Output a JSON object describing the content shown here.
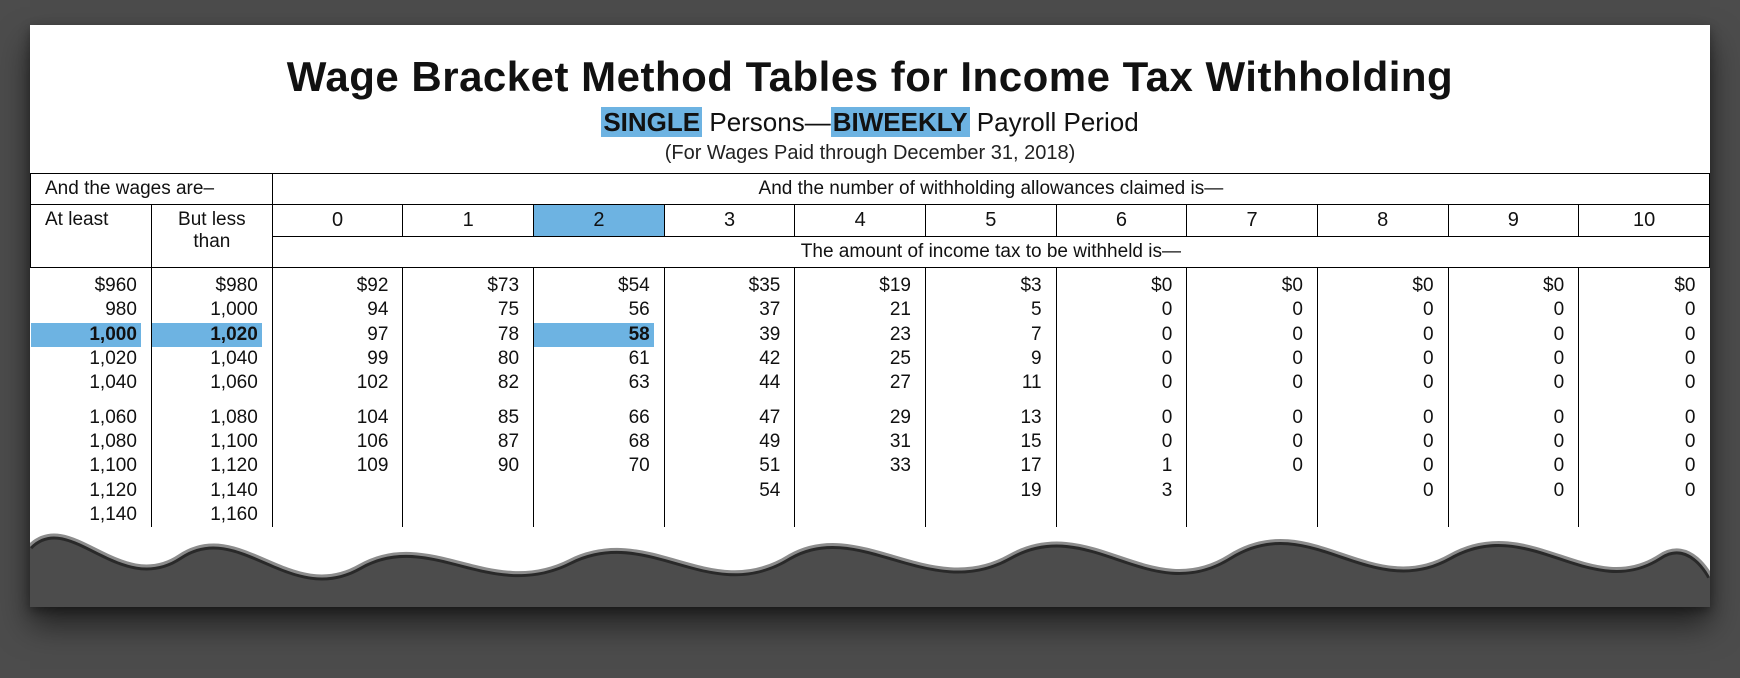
{
  "title": "Wage Bracket Method Tables for Income Tax Withholding",
  "subtitle": {
    "hl1": "SINGLE",
    "mid1": " Persons—",
    "hl2": "BIWEEKLY",
    "mid2": " Payroll Period"
  },
  "date_line": "(For Wages Paid through December 31, 2018)",
  "headers": {
    "wages_label": "And the wages are–",
    "at_least": "At least",
    "but_less_than": "But less than",
    "allowances_label": "And the number of withholding allowances claimed is—",
    "amount_label": "The amount of income tax to be withheld is—",
    "cols": [
      "0",
      "1",
      "2",
      "3",
      "4",
      "5",
      "6",
      "7",
      "8",
      "9",
      "10"
    ]
  },
  "highlight": {
    "col_index": 2,
    "row_index": 2
  },
  "chart_data": {
    "type": "table",
    "title": "Wage Bracket Method Tables for Income Tax Withholding — SINGLE Persons — BIWEEKLY Payroll Period",
    "note": "For Wages Paid through December 31, 2018",
    "x": "Withholding allowances claimed",
    "y": "Wage bracket (at least / but less than)",
    "columns": [
      "at_least",
      "but_less_than",
      "0",
      "1",
      "2",
      "3",
      "4",
      "5",
      "6",
      "7",
      "8",
      "9",
      "10"
    ],
    "rows": [
      {
        "at_least": "$960",
        "but_less_than": "$980",
        "v": [
          "$92",
          "$73",
          "$54",
          "$35",
          "$19",
          "$3",
          "$0",
          "$0",
          "$0",
          "$0",
          "$0"
        ]
      },
      {
        "at_least": "980",
        "but_less_than": "1,000",
        "v": [
          "94",
          "75",
          "56",
          "37",
          "21",
          "5",
          "0",
          "0",
          "0",
          "0",
          "0"
        ]
      },
      {
        "at_least": "1,000",
        "but_less_than": "1,020",
        "v": [
          "97",
          "78",
          "58",
          "39",
          "23",
          "7",
          "0",
          "0",
          "0",
          "0",
          "0"
        ]
      },
      {
        "at_least": "1,020",
        "but_less_than": "1,040",
        "v": [
          "99",
          "80",
          "61",
          "42",
          "25",
          "9",
          "0",
          "0",
          "0",
          "0",
          "0"
        ]
      },
      {
        "at_least": "1,040",
        "but_less_than": "1,060",
        "v": [
          "102",
          "82",
          "63",
          "44",
          "27",
          "11",
          "0",
          "0",
          "0",
          "0",
          "0"
        ]
      },
      {
        "at_least": "1,060",
        "but_less_than": "1,080",
        "v": [
          "104",
          "85",
          "66",
          "47",
          "29",
          "13",
          "0",
          "0",
          "0",
          "0",
          "0"
        ]
      },
      {
        "at_least": "1,080",
        "but_less_than": "1,100",
        "v": [
          "106",
          "87",
          "68",
          "49",
          "31",
          "15",
          "0",
          "0",
          "0",
          "0",
          "0"
        ]
      },
      {
        "at_least": "1,100",
        "but_less_than": "1,120",
        "v": [
          "109",
          "90",
          "70",
          "51",
          "33",
          "17",
          "1",
          "0",
          "0",
          "0",
          "0"
        ]
      },
      {
        "at_least": "1,120",
        "but_less_than": "1,140",
        "v": [
          "",
          "",
          "",
          "54",
          "",
          "19",
          "3",
          "",
          "0",
          "0",
          "0"
        ]
      },
      {
        "at_least": "1,140",
        "but_less_than": "1,160",
        "v": [
          "",
          "",
          "",
          "",
          "",
          "",
          "",
          "",
          "",
          "",
          ""
        ]
      }
    ],
    "row_break_after_index": 4
  }
}
